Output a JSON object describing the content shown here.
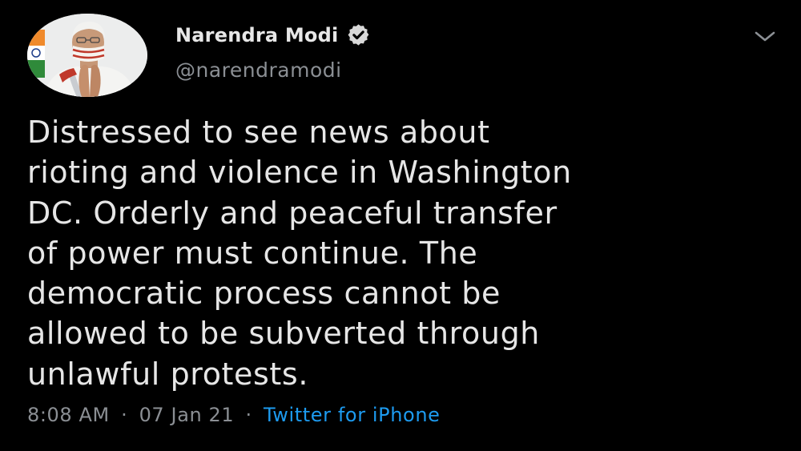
{
  "author": {
    "display_name": "Narendra Modi",
    "handle": "@narendramodi",
    "verified": true
  },
  "tweet": {
    "text": "Distressed to see news about\nrioting and violence in Washington\nDC. Orderly and peaceful transfer\nof power must continue. The\ndemocratic process cannot be\nallowed to be subverted through\nunlawful protests.",
    "time": "8:08 AM",
    "separator": "·",
    "date": "07 Jan 21",
    "source": "Twitter for iPhone"
  },
  "icons": {
    "verified": "verified-badge-icon",
    "menu": "chevron-down-icon"
  },
  "colors": {
    "background": "#000000",
    "text": "#e6e6e6",
    "secondary": "#8b8f94",
    "link": "#1d9bf0"
  }
}
